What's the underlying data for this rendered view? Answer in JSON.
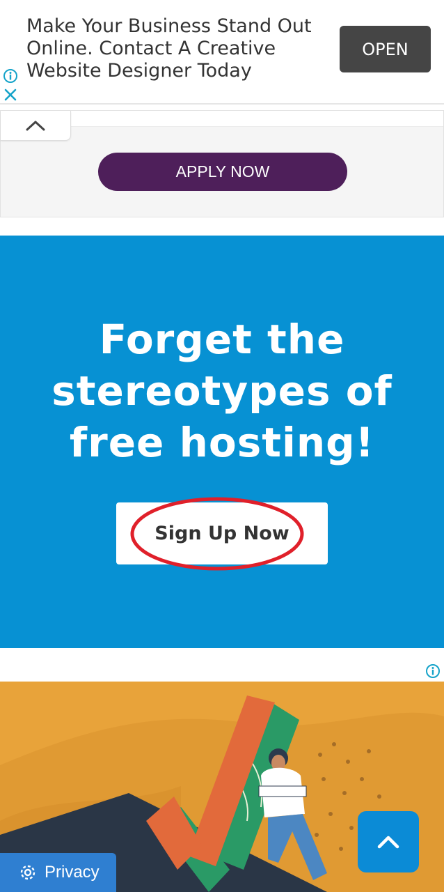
{
  "top_ad": {
    "text": "Make Your Business Stand Out Online. Contact A Creative Website Designer Today",
    "open_label": "OPEN",
    "info_icon": "info-icon",
    "close_icon": "close-icon"
  },
  "panel": {
    "collapse_icon": "chevron-up-icon",
    "apply_label": "APPLY NOW"
  },
  "hero": {
    "headline": "Forget the stereotypes of free hosting!",
    "signup_label": "Sign Up Now"
  },
  "bottom_ad": {
    "info_icon": "info-icon"
  },
  "footer": {
    "privacy_label": "Privacy",
    "privacy_icon": "gear-icon",
    "scroll_top_icon": "chevron-up-icon"
  },
  "colors": {
    "hero_bg": "#0791d3",
    "apply_btn": "#4e1f5a",
    "open_btn": "#454545",
    "highlight_ring": "#e0202a",
    "ad_orange": "#e8a33a",
    "privacy_btn": "#2f7fd1"
  }
}
